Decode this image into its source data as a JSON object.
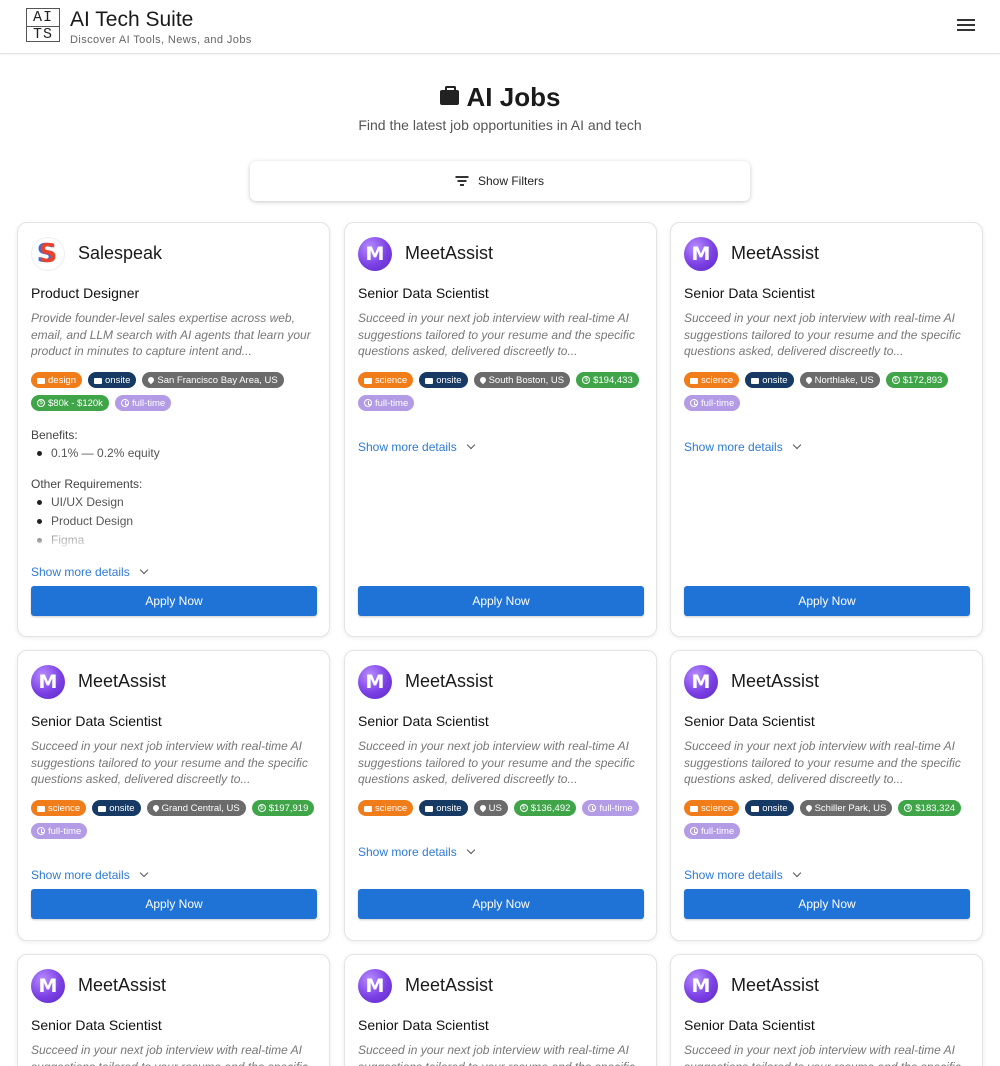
{
  "header": {
    "logo_top": "AI",
    "logo_bottom": "TS",
    "title": "AI Tech Suite",
    "tagline": "Discover AI Tools, News, and Jobs"
  },
  "page": {
    "title": "AI Jobs",
    "subtitle": "Find the latest job opportunities in AI and tech",
    "filter_label": "Show Filters"
  },
  "labels": {
    "benefits": "Benefits:",
    "other_requirements": "Other Requirements:",
    "show_more": "Show more details",
    "apply": "Apply Now"
  },
  "colors": {
    "primary": "#1f73d6",
    "link": "#2f7ad6",
    "tag_category": "#f07d1a",
    "tag_mode": "#163a63",
    "tag_location": "#6b6b6b",
    "tag_salary": "#3fa548",
    "tag_type": "#b39be6"
  },
  "jobs": [
    {
      "company": "Salespeak",
      "logo_icon": "salespeak-logo",
      "title": "Product Designer",
      "description": "Provide founder-level sales expertise across web, email, and LLM search with AI agents that learn your product in minutes to capture intent and...",
      "category": "design",
      "mode": "onsite",
      "location": "San Francisco Bay Area, US",
      "salary": "$80k - $120k",
      "type": "full-time",
      "benefits": [
        "0.1% — 0.2% equity"
      ],
      "requirements": [
        "UI/UX Design",
        "Product Design",
        "Figma"
      ]
    },
    {
      "company": "MeetAssist",
      "logo_icon": "meetassist-logo",
      "title": "Senior Data Scientist",
      "description": "Succeed in your next job interview with real-time AI suggestions tailored to your resume and the specific questions asked, delivered discreetly to...",
      "category": "science",
      "mode": "onsite",
      "location": "South Boston, US",
      "salary": "$194,433",
      "type": "full-time"
    },
    {
      "company": "MeetAssist",
      "logo_icon": "meetassist-logo",
      "title": "Senior Data Scientist",
      "description": "Succeed in your next job interview with real-time AI suggestions tailored to your resume and the specific questions asked, delivered discreetly to...",
      "category": "science",
      "mode": "onsite",
      "location": "Northlake, US",
      "salary": "$172,893",
      "type": "full-time"
    },
    {
      "company": "MeetAssist",
      "logo_icon": "meetassist-logo",
      "title": "Senior Data Scientist",
      "description": "Succeed in your next job interview with real-time AI suggestions tailored to your resume and the specific questions asked, delivered discreetly to...",
      "category": "science",
      "mode": "onsite",
      "location": "Grand Central, US",
      "salary": "$197,919",
      "type": "full-time"
    },
    {
      "company": "MeetAssist",
      "logo_icon": "meetassist-logo",
      "title": "Senior Data Scientist",
      "description": "Succeed in your next job interview with real-time AI suggestions tailored to your resume and the specific questions asked, delivered discreetly to...",
      "category": "science",
      "mode": "onsite",
      "location": "US",
      "salary": "$136,492",
      "type": "full-time"
    },
    {
      "company": "MeetAssist",
      "logo_icon": "meetassist-logo",
      "title": "Senior Data Scientist",
      "description": "Succeed in your next job interview with real-time AI suggestions tailored to your resume and the specific questions asked, delivered discreetly to...",
      "category": "science",
      "mode": "onsite",
      "location": "Schiller Park, US",
      "salary": "$183,324",
      "type": "full-time"
    },
    {
      "company": "MeetAssist",
      "logo_icon": "meetassist-logo",
      "title": "Senior Data Scientist",
      "description": "Succeed in your next job interview with real-time AI suggestions tailored to your resume and the specific questions asked, delivered discreetly to..."
    },
    {
      "company": "MeetAssist",
      "logo_icon": "meetassist-logo",
      "title": "Senior Data Scientist",
      "description": "Succeed in your next job interview with real-time AI suggestions tailored to your resume and the specific questions asked, delivered discreetly to..."
    },
    {
      "company": "MeetAssist",
      "logo_icon": "meetassist-logo",
      "title": "Senior Data Scientist",
      "description": "Succeed in your next job interview with real-time AI suggestions tailored to your resume and the specific questions asked, delivered discreetly to..."
    }
  ]
}
